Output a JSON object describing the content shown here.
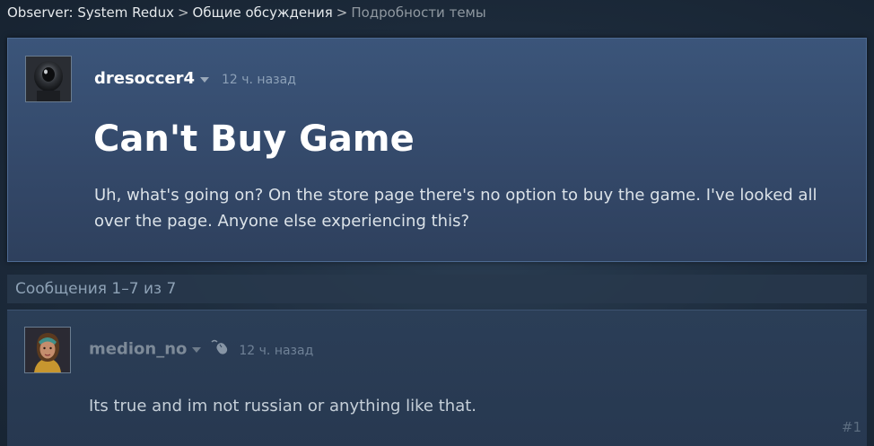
{
  "breadcrumb": {
    "game": "Observer: System Redux",
    "forum": "Общие обсуждения",
    "current": "Подробности темы",
    "separator": ">"
  },
  "topic": {
    "author": "dresoccer4",
    "timestamp": "12 ч. назад",
    "title": "Can't Buy Game",
    "body": "Uh, what's going on? On the store page there's no option to buy the game. I've looked all over the page. Anyone else experiencing this?",
    "avatar_icon": "dark-robot-avatar"
  },
  "messages_count": "Сообщения 1–7 из 7",
  "comments": [
    {
      "author": "medion_no",
      "timestamp": "12 ч. назад",
      "body": "Its true and im not russian or anything like that.",
      "index": "#1",
      "avatar_icon": "character-portrait-avatar",
      "badge_icon": "mouse-icon"
    }
  ],
  "colors": {
    "topic_bg": "#3b557a",
    "page_bg": "#1b2838",
    "muted_text": "#8f98a0"
  }
}
